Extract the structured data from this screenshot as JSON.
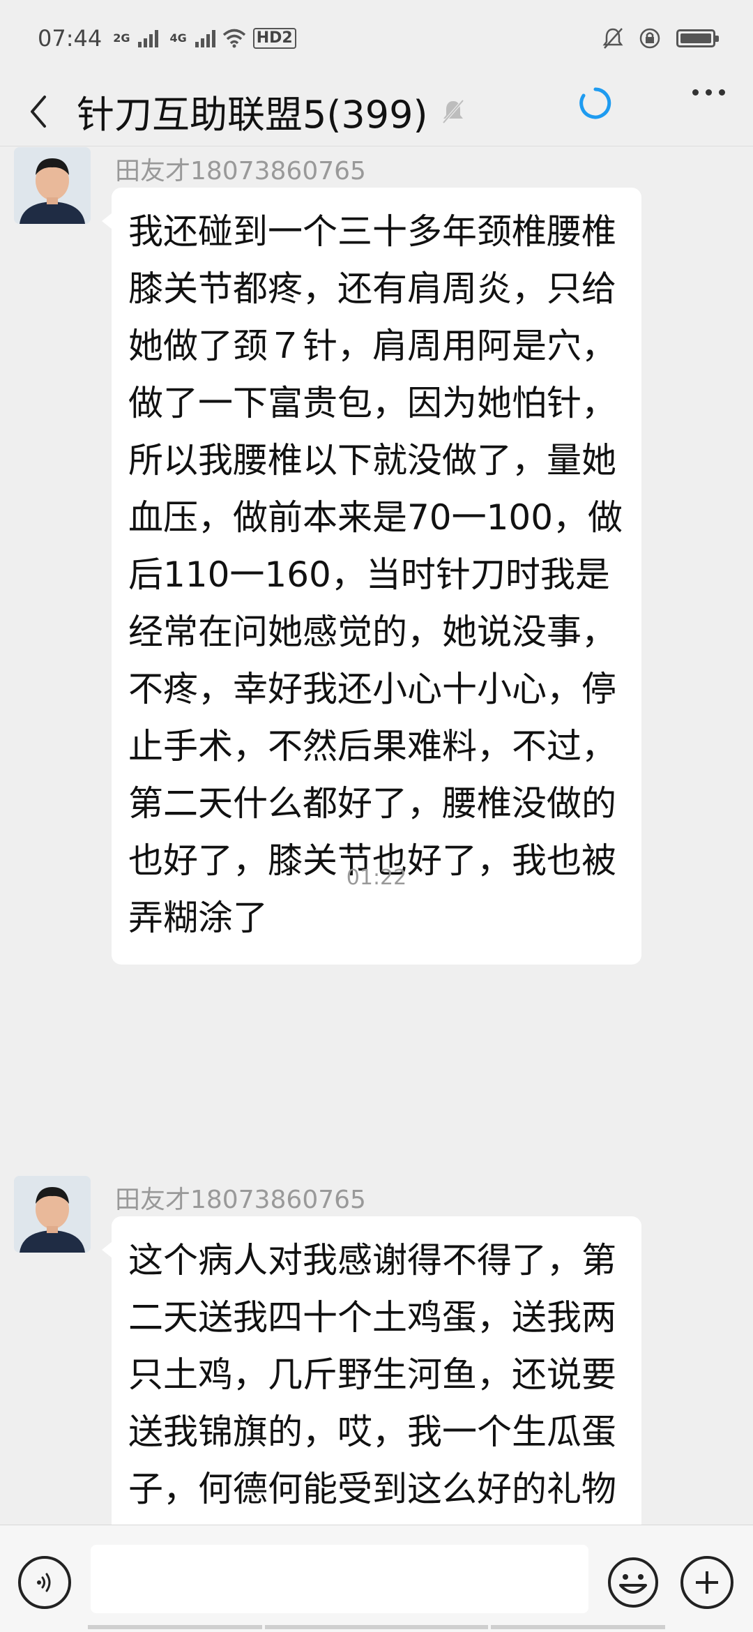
{
  "status_bar": {
    "time": "07:44",
    "net1_top": "2G",
    "net2_top": "4G",
    "hd_label": "HD2"
  },
  "header": {
    "title": "针刀互助联盟5(399)"
  },
  "messages": [
    {
      "sender": "田友才18073860765",
      "text": "我还碰到一个三十多年颈椎腰椎膝关节都疼，还有肩周炎，只给她做了颈７针，肩周用阿是穴，做了一下富贵包，因为她怕针，所以我腰椎以下就没做了，量她血压，做前本来是70一100，做后110一160，当时针刀时我是经常在问她感觉的，她说没事，不疼，幸好我还小心十小心，停止手术，不然后果难料，不过，第二天什么都好了，腰椎没做的也好了，膝关节也好了，我也被弄糊涂了"
    },
    {
      "sender": "田友才18073860765",
      "text": "这个病人对我感谢得不得了，第二天送我四十个土鸡蛋，送我两只土鸡，几斤野生河鱼，还说要送我锦旗的，哎，我一个生瓜蛋子，何德何能受到这么好的礼物"
    }
  ],
  "time_divider": "01:22",
  "input": {
    "placeholder": ""
  },
  "colors": {
    "background": "#efefef",
    "bubble": "#ffffff",
    "loading_accent": "#1e9bf0",
    "sender_text": "#999999"
  },
  "icons": [
    "back-icon",
    "mute-icon",
    "loading-icon",
    "more-icon",
    "voice-icon",
    "emoji-icon",
    "add-icon"
  ]
}
